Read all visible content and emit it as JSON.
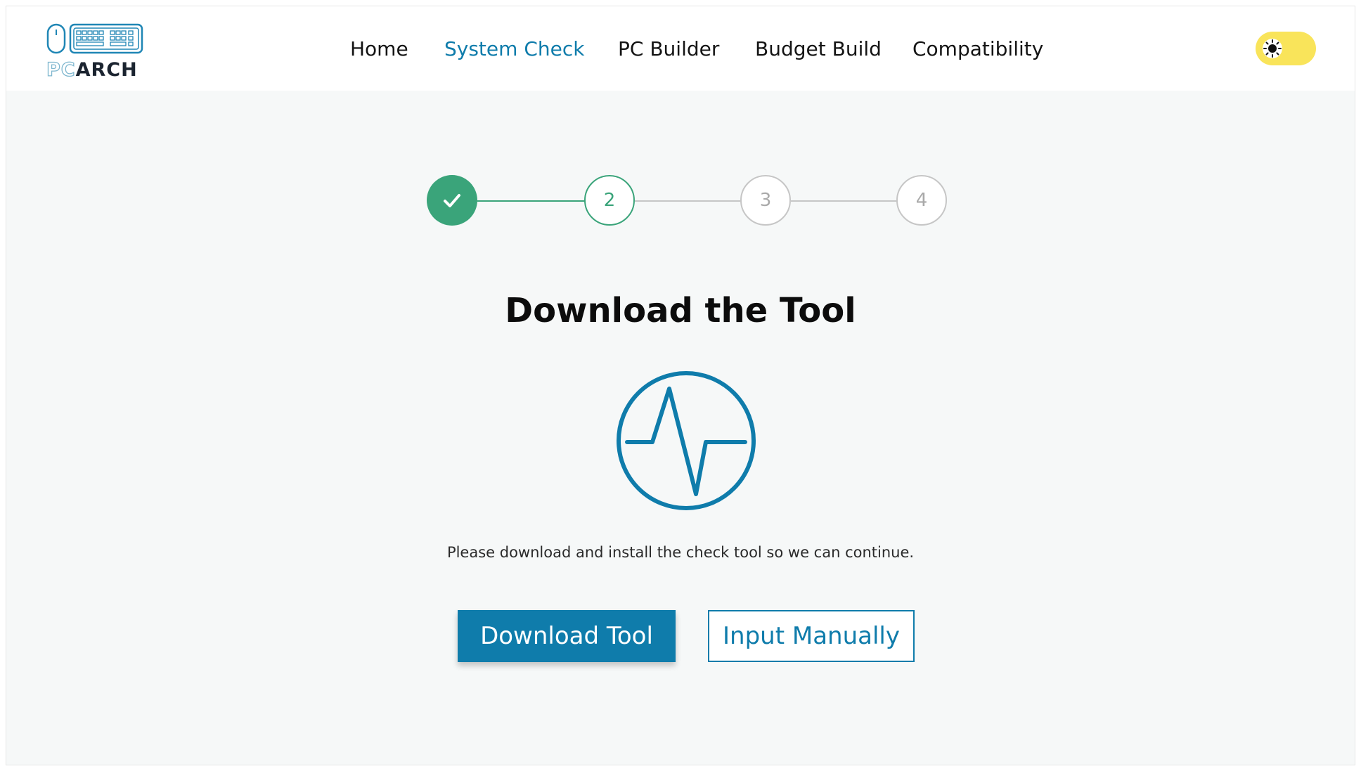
{
  "brand": {
    "pc": "PC",
    "arch": "ARCH"
  },
  "nav": {
    "items": [
      {
        "label": "Home",
        "active": false
      },
      {
        "label": "System Check",
        "active": true
      },
      {
        "label": "PC Builder",
        "active": false
      },
      {
        "label": "Budget Build",
        "active": false
      },
      {
        "label": "Compatibility",
        "active": false
      }
    ]
  },
  "theme_toggle": {
    "icon": "sun-icon",
    "state": "light"
  },
  "stepper": {
    "steps": [
      {
        "label": "",
        "state": "completed",
        "icon": "check-icon"
      },
      {
        "label": "2",
        "state": "current"
      },
      {
        "label": "3",
        "state": "upcoming"
      },
      {
        "label": "4",
        "state": "upcoming"
      }
    ]
  },
  "main": {
    "title": "Download the Tool",
    "icon": "pulse-icon",
    "description": "Please download and install the check tool so we can continue.",
    "primary_button": "Download Tool",
    "secondary_button": "Input Manually"
  },
  "colors": {
    "accent": "#0f7cab",
    "success": "#3aa47a",
    "muted": "#c6c6c6",
    "toggle": "#f9e45a"
  }
}
